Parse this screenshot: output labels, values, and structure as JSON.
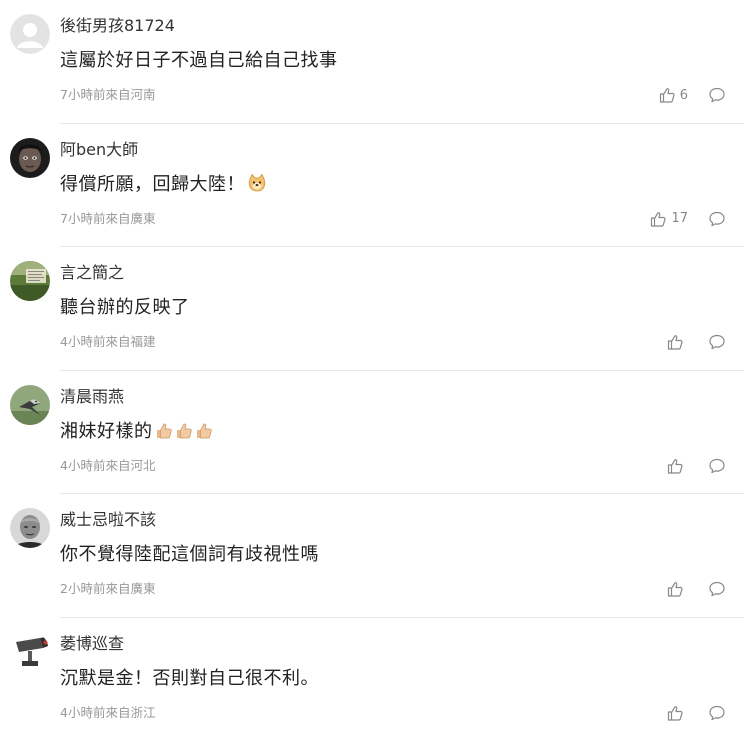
{
  "comments": [
    {
      "username": "後街男孩81724",
      "text": "這屬於好日子不過自己給自己找事",
      "meta": "7小時前來自河南",
      "likes": "6",
      "avatar": "default-gray-avatar",
      "emoji": ""
    },
    {
      "username": "阿ben大師",
      "text": "得償所願，回歸大陸！",
      "meta": "7小時前來自廣東",
      "likes": "17",
      "avatar": "dark-face-photo-avatar",
      "emoji": "doge-emoji"
    },
    {
      "username": "言之簡之",
      "text": "聽台辦的反映了",
      "meta": "4小時前來自福建",
      "likes": "",
      "avatar": "green-landscape-avatar",
      "emoji": ""
    },
    {
      "username": "清晨雨燕",
      "text": "湘妹好樣的",
      "meta": "4小時前來自河北",
      "likes": "",
      "avatar": "bird-on-green-avatar",
      "emoji": "thumbs-up-emoji-x3"
    },
    {
      "username": "威士忌啦不該",
      "text": "你不覺得陸配這個詞有歧視性嗎",
      "meta": "2小時前來自廣東",
      "likes": "",
      "avatar": "bald-man-photo-avatar",
      "emoji": ""
    },
    {
      "username": "萎博巡查",
      "text": "沉默是金！否則對自己很不利。",
      "meta": "4小時前來自浙江",
      "likes": "",
      "avatar": "cctv-camera-avatar",
      "emoji": ""
    }
  ],
  "colors": {
    "meta_text": "#999999",
    "divider": "#e8e8e8",
    "icon_stroke": "#888888"
  }
}
